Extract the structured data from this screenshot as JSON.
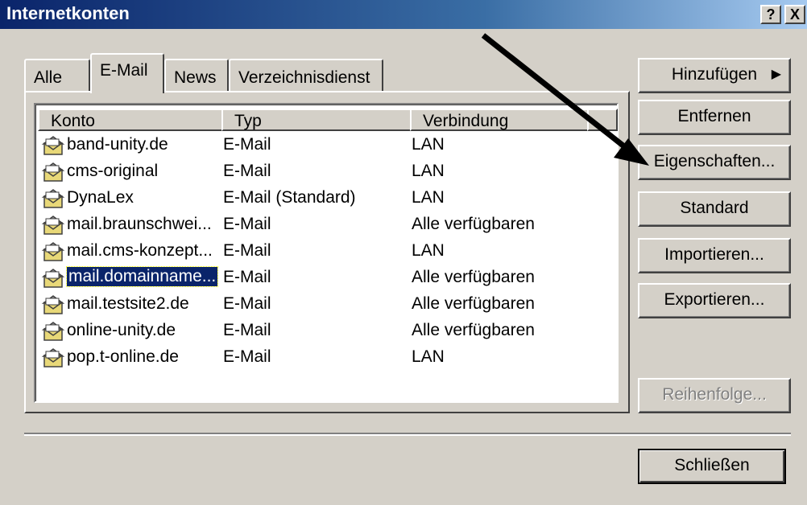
{
  "window": {
    "title": "Internetkonten",
    "help_label": "?",
    "close_label": "X"
  },
  "tabs": [
    {
      "label": "Alle",
      "active": false
    },
    {
      "label": "E-Mail",
      "active": true
    },
    {
      "label": "News",
      "active": false
    },
    {
      "label": "Verzeichnisdienst",
      "active": false
    }
  ],
  "columns": [
    "Konto",
    "Typ",
    "Verbindung"
  ],
  "accounts": [
    {
      "konto": "band-unity.de",
      "typ": "E-Mail",
      "verbindung": "LAN"
    },
    {
      "konto": "cms-original",
      "typ": "E-Mail",
      "verbindung": "LAN"
    },
    {
      "konto": "DynaLex",
      "typ": "E-Mail (Standard)",
      "verbindung": "LAN"
    },
    {
      "konto": "mail.braunschwei...",
      "typ": "E-Mail",
      "verbindung": "Alle verfügbaren"
    },
    {
      "konto": "mail.cms-konzept...",
      "typ": "E-Mail",
      "verbindung": "LAN"
    },
    {
      "konto": "mail.domainname...",
      "typ": "E-Mail",
      "verbindung": "Alle verfügbaren",
      "selected": true
    },
    {
      "konto": "mail.testsite2.de",
      "typ": "E-Mail",
      "verbindung": "Alle verfügbaren"
    },
    {
      "konto": "online-unity.de",
      "typ": "E-Mail",
      "verbindung": "Alle verfügbaren"
    },
    {
      "konto": "pop.t-online.de",
      "typ": "E-Mail",
      "verbindung": "LAN"
    }
  ],
  "buttons": {
    "add": "Hinzufügen",
    "remove": "Entfernen",
    "properties": "Eigenschaften...",
    "default": "Standard",
    "import": "Importieren...",
    "export": "Exportieren...",
    "order": "Reihenfolge...",
    "close": "Schließen"
  },
  "icons": {
    "account": "mail-account-icon",
    "add_arrow": "triangle-right-icon"
  }
}
